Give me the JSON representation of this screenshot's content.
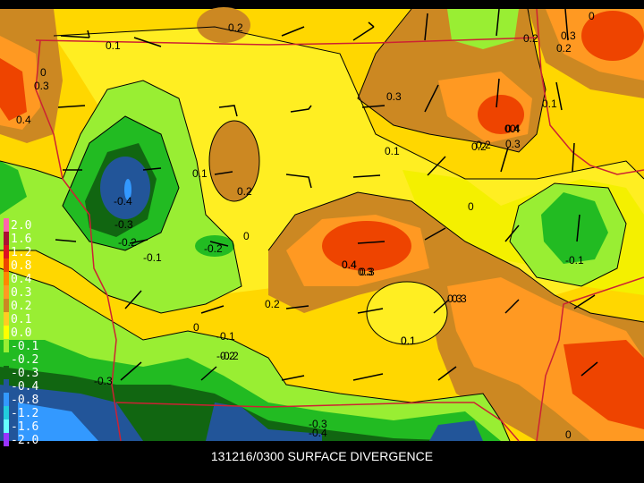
{
  "caption": "131216/0300 SURFACE DIVERGENCE",
  "legend": {
    "entries": [
      {
        "label": "2.0",
        "color": "#ff66aa"
      },
      {
        "label": "1.6",
        "color": "#aa1133"
      },
      {
        "label": "1.2",
        "color": "#dd1122"
      },
      {
        "label": "0.8",
        "color": "#ee4400"
      },
      {
        "label": "0.4",
        "color": "#ff8800"
      },
      {
        "label": "0.3",
        "color": "#ff9922"
      },
      {
        "label": "0.2",
        "color": "#cc8822"
      },
      {
        "label": "0.1",
        "color": "#ffcc22"
      },
      {
        "label": "0.0",
        "color": "#ffff00"
      },
      {
        "label": "-0.1",
        "color": "#99ee33"
      },
      {
        "label": "-0.2",
        "color": "#22bb22"
      },
      {
        "label": "-0.3",
        "color": "#116611"
      },
      {
        "label": "-0.4",
        "color": "#225599"
      },
      {
        "label": "-0.8",
        "color": "#3399ff"
      },
      {
        "label": "-1.2",
        "color": "#22ccdd"
      },
      {
        "label": "-1.6",
        "color": "#66ffff"
      },
      {
        "label": "-2.0",
        "color": "#9933ff"
      }
    ]
  },
  "contour_labels": [
    "0.2",
    "0.1",
    "0.3",
    "0",
    "0.4",
    "0.3",
    "0.2",
    "-0.4",
    "-0.3",
    "-0.2",
    "-0.1",
    "0.1",
    "0.2",
    "0",
    "-0.2",
    "0.4",
    "0.3",
    "0.2",
    "0.3",
    "0.4",
    "0.3",
    "0.2",
    "0.1",
    "0.1",
    "0",
    "-0.1",
    "0",
    "0.4",
    "0.3",
    "0.2",
    "0.3",
    "0.1",
    "0",
    "-0.1",
    "-0.2",
    "-0.3",
    "0",
    "-0.3",
    "-0.4",
    "0.4",
    "0.3",
    "0.2",
    "0",
    "0.1",
    "-0.2"
  ]
}
